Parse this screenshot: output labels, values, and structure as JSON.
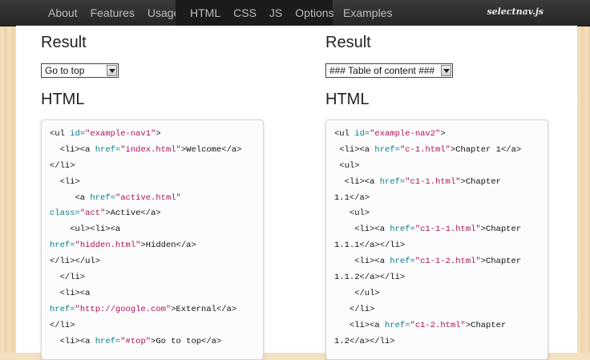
{
  "nav": {
    "items_left": [
      "About",
      "Features",
      "Usage"
    ],
    "items_dark": [
      "HTML",
      "CSS",
      "JS",
      "Options"
    ],
    "items_right": [
      "Examples"
    ],
    "brand": "selectnav.js"
  },
  "left": {
    "result_heading": "Result",
    "select_value": "Go to top",
    "html_heading": "HTML",
    "code_lines": [
      [
        [
          "t",
          "<ul "
        ],
        [
          "a",
          "id="
        ],
        [
          "v",
          "\"example-nav1\""
        ],
        [
          "t",
          ">"
        ]
      ],
      [
        [
          "t",
          "  <li><a "
        ],
        [
          "a",
          "href="
        ],
        [
          "v",
          "\"index.html\""
        ],
        [
          "t",
          ">Welcome</a>"
        ]
      ],
      [
        [
          "t",
          "</li>"
        ]
      ],
      [
        [
          "t",
          "  <li>"
        ]
      ],
      [
        [
          "t",
          "     <a "
        ],
        [
          "a",
          "href="
        ],
        [
          "v",
          "\"active.html\""
        ]
      ],
      [
        [
          "a",
          "class="
        ],
        [
          "v",
          "\"act\""
        ],
        [
          "t",
          ">Active</a>"
        ]
      ],
      [
        [
          "t",
          "    <ul><li><a"
        ]
      ],
      [
        [
          "a",
          "href="
        ],
        [
          "v",
          "\"hidden.html\""
        ],
        [
          "t",
          ">Hidden</a>"
        ]
      ],
      [
        [
          "t",
          "</li></ul>"
        ]
      ],
      [
        [
          "t",
          "  </li>"
        ]
      ],
      [
        [
          "t",
          "  <li><a"
        ]
      ],
      [
        [
          "a",
          "href="
        ],
        [
          "v",
          "\"http://google.com\""
        ],
        [
          "t",
          ">External</a>"
        ]
      ],
      [
        [
          "t",
          "</li>"
        ]
      ],
      [
        [
          "t",
          "  <li><a "
        ],
        [
          "a",
          "href="
        ],
        [
          "v",
          "\"#top\""
        ],
        [
          "t",
          ">Go to top</a>"
        ]
      ]
    ]
  },
  "right": {
    "result_heading": "Result",
    "select_value": "### Table of content ###",
    "html_heading": "HTML",
    "code_lines": [
      [
        [
          "t",
          "<ul "
        ],
        [
          "a",
          "id="
        ],
        [
          "v",
          "\"example-nav2\""
        ],
        [
          "t",
          ">"
        ]
      ],
      [
        [
          "t",
          " <li><a "
        ],
        [
          "a",
          "href="
        ],
        [
          "v",
          "\"c-1.html\""
        ],
        [
          "t",
          ">Chapter 1</a>"
        ]
      ],
      [
        [
          "t",
          " <ul>"
        ]
      ],
      [
        [
          "t",
          "  <li><a "
        ],
        [
          "a",
          "href="
        ],
        [
          "v",
          "\"c1-1.html\""
        ],
        [
          "t",
          ">Chapter"
        ]
      ],
      [
        [
          "t",
          "1.1</a>"
        ]
      ],
      [
        [
          "t",
          "   <ul>"
        ]
      ],
      [
        [
          "t",
          "    <li><a "
        ],
        [
          "a",
          "href="
        ],
        [
          "v",
          "\"c1-1-1.html\""
        ],
        [
          "t",
          ">Chapter"
        ]
      ],
      [
        [
          "t",
          "1.1.1</a></li>"
        ]
      ],
      [
        [
          "t",
          "    <li><a "
        ],
        [
          "a",
          "href="
        ],
        [
          "v",
          "\"c1-1-2.html\""
        ],
        [
          "t",
          ">Chapter"
        ]
      ],
      [
        [
          "t",
          "1.1.2</a></li>"
        ]
      ],
      [
        [
          "t",
          "    </ul>"
        ]
      ],
      [
        [
          "t",
          "   </li>"
        ]
      ],
      [
        [
          "t",
          "   <li><a "
        ],
        [
          "a",
          "href="
        ],
        [
          "v",
          "\"c1-2.html\""
        ],
        [
          "t",
          ">Chapter"
        ]
      ],
      [
        [
          "t",
          "1.2</a></li>"
        ]
      ]
    ]
  }
}
